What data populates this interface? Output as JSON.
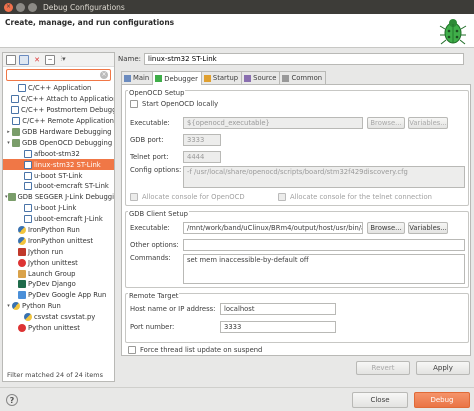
{
  "window": {
    "title": "Debug Configurations"
  },
  "header": {
    "heading": "Create, manage, and run configurations"
  },
  "left": {
    "filter_value": "",
    "tree": [
      {
        "label": "C/C++ Application",
        "indent": 1,
        "arrow": "",
        "icon": "c"
      },
      {
        "label": "C/C++ Attach to Application",
        "indent": 1,
        "arrow": "",
        "icon": "c"
      },
      {
        "label": "C/C++ Postmortem Debugger",
        "indent": 1,
        "arrow": "",
        "icon": "c"
      },
      {
        "label": "C/C++ Remote Application",
        "indent": 1,
        "arrow": "",
        "icon": "c"
      },
      {
        "label": "GDB Hardware Debugging",
        "indent": 0,
        "arrow": "▸",
        "icon": "gdb"
      },
      {
        "label": "GDB OpenOCD Debugging",
        "indent": 0,
        "arrow": "▾",
        "icon": "gdb"
      },
      {
        "label": "afboot-stm32",
        "indent": 2,
        "arrow": "",
        "icon": "c"
      },
      {
        "label": "linux-stm32 ST-Link",
        "indent": 2,
        "arrow": "",
        "icon": "c",
        "selected": true
      },
      {
        "label": "u-boot ST-Link",
        "indent": 2,
        "arrow": "",
        "icon": "c"
      },
      {
        "label": "uboot-emcraft ST-Link",
        "indent": 2,
        "arrow": "",
        "icon": "c"
      },
      {
        "label": "GDB SEGGER J-Link Debugging",
        "indent": 0,
        "arrow": "▾",
        "icon": "gdb"
      },
      {
        "label": "u-boot J-Link",
        "indent": 2,
        "arrow": "",
        "icon": "c"
      },
      {
        "label": "uboot-emcraft J-Link",
        "indent": 2,
        "arrow": "",
        "icon": "c"
      },
      {
        "label": "IronPython Run",
        "indent": 1,
        "arrow": "",
        "icon": "py"
      },
      {
        "label": "IronPython unittest",
        "indent": 1,
        "arrow": "",
        "icon": "py"
      },
      {
        "label": "Jython run",
        "indent": 1,
        "arrow": "",
        "icon": "jy"
      },
      {
        "label": "Jython unittest",
        "indent": 1,
        "arrow": "",
        "icon": "ut"
      },
      {
        "label": "Launch Group",
        "indent": 1,
        "arrow": "",
        "icon": "launch"
      },
      {
        "label": "PyDev Django",
        "indent": 1,
        "arrow": "",
        "icon": "dj"
      },
      {
        "label": "PyDev Google App Run",
        "indent": 1,
        "arrow": "",
        "icon": "gae"
      },
      {
        "label": "Python Run",
        "indent": 0,
        "arrow": "▾",
        "icon": "py"
      },
      {
        "label": "csvstat csvstat.py",
        "indent": 2,
        "arrow": "",
        "icon": "py"
      },
      {
        "label": "Python unittest",
        "indent": 1,
        "arrow": "",
        "icon": "ut"
      }
    ],
    "status": "Filter matched 24 of 24 items"
  },
  "config": {
    "name_label": "Name:",
    "name_value": "linux-stm32 ST-Link",
    "tabs": [
      {
        "label": "Main",
        "icon": "main"
      },
      {
        "label": "Debugger",
        "icon": "debugger",
        "active": true
      },
      {
        "label": "Startup",
        "icon": "startup"
      },
      {
        "label": "Source",
        "icon": "source"
      },
      {
        "label": "Common",
        "icon": "common"
      }
    ]
  },
  "openocd": {
    "title": "OpenOCD Setup",
    "start_locally": "Start OpenOCD locally",
    "executable_label": "Executable:",
    "executable_value": "${openocd_executable}",
    "browse": "Browse...",
    "variables": "Variables...",
    "gdb_port_label": "GDB port:",
    "gdb_port_value": "3333",
    "telnet_port_label": "Telnet port:",
    "telnet_port_value": "4444",
    "config_label": "Config options:",
    "config_value": "-f /usr/local/share/openocd/scripts/board/stm32f429discovery.cfg",
    "allocate_console": "Allocate console for OpenOCD",
    "allocate_telnet": "Allocate console for the telnet connection"
  },
  "gdbclient": {
    "title": "GDB Client Setup",
    "executable_label": "Executable:",
    "executable_value": "/mnt/work/band/uClinux/BRm4/output/host/usr/bin/a",
    "browse": "Browse...",
    "variables": "Variables...",
    "other_label": "Other options:",
    "other_value": "",
    "commands_label": "Commands:",
    "commands_value": "set mem inaccessible-by-default off"
  },
  "remote": {
    "title": "Remote Target",
    "host_label": "Host name or IP address:",
    "host_value": "localhost",
    "port_label": "Port number:",
    "port_value": "3333",
    "force_thread": "Force thread list update on suspend"
  },
  "actions": {
    "revert": "Revert",
    "apply": "Apply"
  },
  "footer": {
    "help": "?",
    "close": "Close",
    "debug": "Debug"
  },
  "colors": {
    "accent": "#f07746",
    "titlebar": "#3d3c38"
  }
}
